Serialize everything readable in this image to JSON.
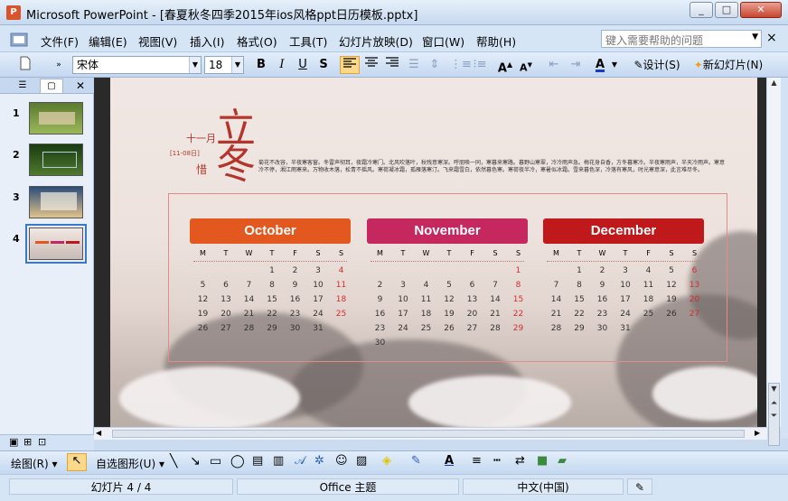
{
  "window": {
    "title": "Microsoft PowerPoint - [春夏秋冬四季2015年ios风格ppt日历模板.pptx]",
    "minimize": "_",
    "restore": "□",
    "close": "✕"
  },
  "menubar": {
    "items": [
      "文件(F)",
      "编辑(E)",
      "视图(V)",
      "插入(I)",
      "格式(O)",
      "工具(T)",
      "幻灯片放映(D)",
      "窗口(W)",
      "帮助(H)"
    ],
    "help_placeholder": "键入需要帮助的问题",
    "close": "×"
  },
  "toolbar": {
    "font_name": "宋体",
    "font_size": "18",
    "bold": "B",
    "italic": "I",
    "underline": "U",
    "shadow": "S",
    "font_color": "A",
    "design": "设计(S)",
    "new_slide": "新幻灯片(N)"
  },
  "panel": {
    "slides": [
      "1",
      "2",
      "3",
      "4"
    ],
    "selected": 4
  },
  "slide": {
    "solar_char_1": "立",
    "solar_char_2": "冬",
    "solar_month": "十一月",
    "solar_date": "[11-08日]",
    "solar_name": "惜",
    "poem": "菊花不改容，半夜寒客窗。冬雷声彻耳，夜霜冷寒门。北风吹落叶，秋残意寒深。呼朋唤一同，寒暮来寒路。暮野山寒翠，冷冷雨声急。梅花身自香，方冬暮寒冷。半夜寒雨声，半天冷雨声。寒意冷不停，湘江雨寒来。万物收木落，松青不摇风。寒荷凝冰霜，孤雁落寒汀。飞来霜雪白，依然暮色寒。寒荷夜半冷，寒暑似冰霜。雪来暮色深，冷落有寒风，时光寒意深，此言难尽冬。",
    "dow": [
      "M",
      "T",
      "W",
      "T",
      "F",
      "S",
      "S"
    ],
    "months": [
      {
        "name": "October",
        "color": "#e2581e",
        "weeks": [
          [
            "",
            "",
            "",
            "1",
            "2",
            "3",
            "4"
          ],
          [
            "5",
            "6",
            "7",
            "8",
            "9",
            "10",
            "11"
          ],
          [
            "12",
            "13",
            "14",
            "15",
            "16",
            "17",
            "18"
          ],
          [
            "19",
            "20",
            "21",
            "22",
            "23",
            "24",
            "25"
          ],
          [
            "26",
            "27",
            "28",
            "29",
            "30",
            "31",
            ""
          ]
        ]
      },
      {
        "name": "November",
        "color": "#c4285e",
        "weeks": [
          [
            "",
            "",
            "",
            "",
            "",
            "",
            "1"
          ],
          [
            "2",
            "3",
            "4",
            "5",
            "6",
            "7",
            "8"
          ],
          [
            "9",
            "10",
            "11",
            "12",
            "13",
            "14",
            "15"
          ],
          [
            "16",
            "17",
            "18",
            "19",
            "20",
            "21",
            "22"
          ],
          [
            "23",
            "24",
            "25",
            "26",
            "27",
            "28",
            "29"
          ],
          [
            "30",
            "",
            "",
            "",
            "",
            "",
            ""
          ]
        ]
      },
      {
        "name": "December",
        "color": "#c0191b",
        "weeks": [
          [
            "",
            "1",
            "2",
            "3",
            "4",
            "5",
            "6"
          ],
          [
            "7",
            "8",
            "9",
            "10",
            "11",
            "12",
            "13"
          ],
          [
            "14",
            "15",
            "16",
            "17",
            "18",
            "19",
            "20"
          ],
          [
            "21",
            "22",
            "23",
            "24",
            "25",
            "26",
            "27"
          ],
          [
            "28",
            "29",
            "30",
            "31",
            "",
            "",
            ""
          ]
        ]
      }
    ]
  },
  "drawbar": {
    "draw": "绘图(R)",
    "autoshapes": "自选图形(U)"
  },
  "statusbar": {
    "slide": "幻灯片 4 / 4",
    "theme": "Office 主题",
    "language": "中文(中国)"
  }
}
